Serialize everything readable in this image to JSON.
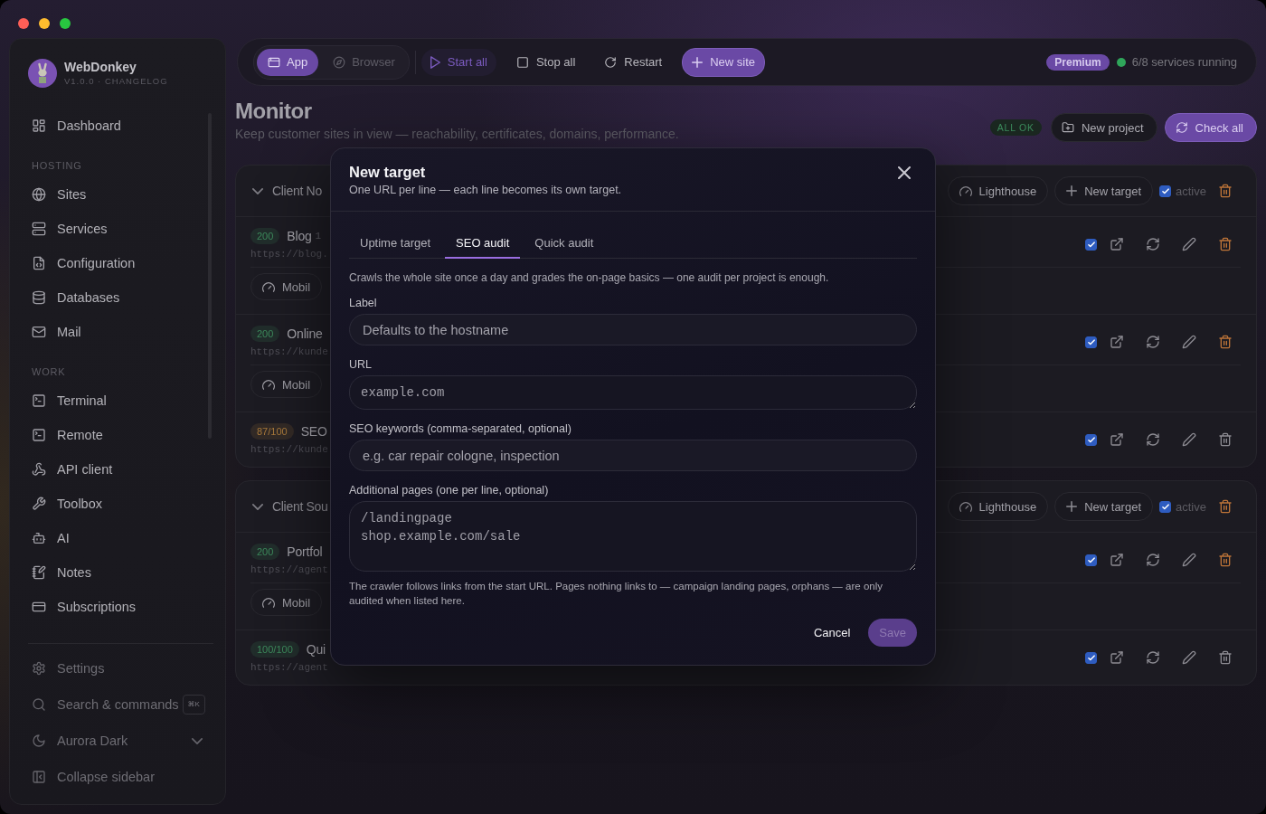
{
  "sidebar": {
    "app_name": "WebDonkey",
    "version": "V1.0.0 · CHANGELOG",
    "sections": [
      {
        "items": [
          {
            "label": "Dashboard",
            "selected": false
          }
        ]
      },
      {
        "heading": "HOSTING",
        "items": [
          {
            "label": "Sites",
            "selected": false
          },
          {
            "label": "Services",
            "selected": false
          },
          {
            "label": "Configuration",
            "selected": false
          },
          {
            "label": "Databases",
            "selected": false
          },
          {
            "label": "Mail",
            "selected": false
          }
        ]
      },
      {
        "heading": "WORK",
        "items": [
          {
            "label": "Terminal",
            "selected": false
          },
          {
            "label": "Remote",
            "selected": false
          },
          {
            "label": "API client",
            "selected": false
          },
          {
            "label": "Toolbox",
            "selected": false
          },
          {
            "label": "AI",
            "selected": false
          },
          {
            "label": "Notes",
            "selected": false
          },
          {
            "label": "Subscriptions",
            "selected": false
          }
        ]
      }
    ],
    "footer": [
      {
        "label": "Settings",
        "kind": "link"
      },
      {
        "label": "Search & commands",
        "kind": "search",
        "shortcut": "⌘K"
      },
      {
        "label": "Aurora Dark",
        "kind": "select"
      },
      {
        "label": "Collapse sidebar",
        "kind": "link"
      }
    ]
  },
  "toolbar": {
    "modes": [
      {
        "label": "App",
        "selected": true
      },
      {
        "label": "Browser",
        "selected": false
      }
    ],
    "actions": [
      {
        "label": "Start all",
        "kind": "accent"
      },
      {
        "label": "Stop all",
        "kind": "plain"
      },
      {
        "label": "Restart",
        "kind": "plain"
      },
      {
        "label": "New site",
        "kind": "primary"
      }
    ],
    "plan": "Premium",
    "status": "6/8 services running"
  },
  "page": {
    "title": "Monitor",
    "subtitle": "Keep customer sites in view — reachability, certificates, domains, performance.",
    "overall": "ALL OK",
    "actions": [
      {
        "label": "New project",
        "kind": "secondary"
      },
      {
        "label": "Check all",
        "kind": "primary"
      }
    ]
  },
  "projects": [
    {
      "name": "Client No",
      "expanded": true,
      "buttons": [
        "Lighthouse",
        "New target"
      ],
      "active": true,
      "active_label": "active",
      "targets": [
        {
          "kind": "uptime",
          "badge": "200",
          "color": "#3d8a5c",
          "name": "Blog",
          "count": "1",
          "url": "https://blog.",
          "chip": "Mobil",
          "active": true
        },
        {
          "kind": "uptime",
          "badge": "200",
          "color": "#3d8a5c",
          "name": "Online",
          "url": "https://kunde",
          "chip": "Mobil",
          "active": true
        },
        {
          "kind": "audit",
          "badge": "87/100",
          "color": "#a8793b",
          "name": "SEO",
          "url": "https://kunde",
          "active": true
        }
      ]
    },
    {
      "name": "Client Sou",
      "expanded": true,
      "buttons": [
        "Lighthouse",
        "New target"
      ],
      "active": true,
      "active_label": "active",
      "targets": [
        {
          "kind": "uptime",
          "badge": "200",
          "color": "#3d8a5c",
          "name": "Portfol",
          "url": "https://agent",
          "chip": "Mobil",
          "active": true
        },
        {
          "kind": "audit",
          "badge": "100/100",
          "color": "#3d8a5c",
          "name": "Qui",
          "url": "https://agent",
          "active": true
        }
      ]
    }
  ],
  "dialog": {
    "title": "New target",
    "subtitle": "One URL per line — each line becomes its own target.",
    "tabs": [
      {
        "label": "Uptime target",
        "selected": false
      },
      {
        "label": "SEO audit",
        "selected": true
      },
      {
        "label": "Quick audit",
        "selected": false
      }
    ],
    "description": "Crawls the whole site once a day and grades the on-page basics — one audit per project is enough.",
    "fields": [
      {
        "label": "Label",
        "kind": "input",
        "placeholder": "Defaults to the hostname"
      },
      {
        "label": "URL",
        "kind": "textarea",
        "placeholder": "example.com"
      },
      {
        "label": "SEO keywords (comma-separated, optional)",
        "kind": "input",
        "placeholder": "e.g. car repair cologne, inspection"
      },
      {
        "label": "Additional pages (one per line, optional)",
        "kind": "textarea",
        "placeholder": "/landingpage\nshop.example.com/sale"
      }
    ],
    "note": "The crawler follows links from the start URL. Pages nothing links to — campaign landing pages, orphans — are only audited when listed here.",
    "cancel": "Cancel",
    "save": {
      "label": "Save",
      "disabled": true
    }
  }
}
